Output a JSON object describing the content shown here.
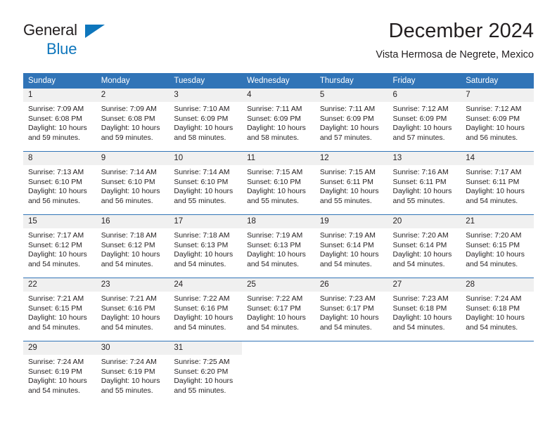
{
  "brand": {
    "word1": "General",
    "word2": "Blue",
    "triangle_color": "#0e76bc",
    "word1_color": "#231f20"
  },
  "header": {
    "title": "December 2024",
    "subtitle": "Vista Hermosa de Negrete, Mexico"
  },
  "theme": {
    "header_bg": "#3174b7",
    "header_text": "#ffffff",
    "daynum_bg": "#f0f0f0",
    "body_text": "#231f20",
    "row_divider": "#3174b7"
  },
  "calendar": {
    "weekday_headers": [
      "Sunday",
      "Monday",
      "Tuesday",
      "Wednesday",
      "Thursday",
      "Friday",
      "Saturday"
    ],
    "weeks": [
      [
        {
          "day": "1",
          "sunrise": "Sunrise: 7:09 AM",
          "sunset": "Sunset: 6:08 PM",
          "daylight1": "Daylight: 10 hours",
          "daylight2": "and 59 minutes."
        },
        {
          "day": "2",
          "sunrise": "Sunrise: 7:09 AM",
          "sunset": "Sunset: 6:08 PM",
          "daylight1": "Daylight: 10 hours",
          "daylight2": "and 59 minutes."
        },
        {
          "day": "3",
          "sunrise": "Sunrise: 7:10 AM",
          "sunset": "Sunset: 6:09 PM",
          "daylight1": "Daylight: 10 hours",
          "daylight2": "and 58 minutes."
        },
        {
          "day": "4",
          "sunrise": "Sunrise: 7:11 AM",
          "sunset": "Sunset: 6:09 PM",
          "daylight1": "Daylight: 10 hours",
          "daylight2": "and 58 minutes."
        },
        {
          "day": "5",
          "sunrise": "Sunrise: 7:11 AM",
          "sunset": "Sunset: 6:09 PM",
          "daylight1": "Daylight: 10 hours",
          "daylight2": "and 57 minutes."
        },
        {
          "day": "6",
          "sunrise": "Sunrise: 7:12 AM",
          "sunset": "Sunset: 6:09 PM",
          "daylight1": "Daylight: 10 hours",
          "daylight2": "and 57 minutes."
        },
        {
          "day": "7",
          "sunrise": "Sunrise: 7:12 AM",
          "sunset": "Sunset: 6:09 PM",
          "daylight1": "Daylight: 10 hours",
          "daylight2": "and 56 minutes."
        }
      ],
      [
        {
          "day": "8",
          "sunrise": "Sunrise: 7:13 AM",
          "sunset": "Sunset: 6:10 PM",
          "daylight1": "Daylight: 10 hours",
          "daylight2": "and 56 minutes."
        },
        {
          "day": "9",
          "sunrise": "Sunrise: 7:14 AM",
          "sunset": "Sunset: 6:10 PM",
          "daylight1": "Daylight: 10 hours",
          "daylight2": "and 56 minutes."
        },
        {
          "day": "10",
          "sunrise": "Sunrise: 7:14 AM",
          "sunset": "Sunset: 6:10 PM",
          "daylight1": "Daylight: 10 hours",
          "daylight2": "and 55 minutes."
        },
        {
          "day": "11",
          "sunrise": "Sunrise: 7:15 AM",
          "sunset": "Sunset: 6:10 PM",
          "daylight1": "Daylight: 10 hours",
          "daylight2": "and 55 minutes."
        },
        {
          "day": "12",
          "sunrise": "Sunrise: 7:15 AM",
          "sunset": "Sunset: 6:11 PM",
          "daylight1": "Daylight: 10 hours",
          "daylight2": "and 55 minutes."
        },
        {
          "day": "13",
          "sunrise": "Sunrise: 7:16 AM",
          "sunset": "Sunset: 6:11 PM",
          "daylight1": "Daylight: 10 hours",
          "daylight2": "and 55 minutes."
        },
        {
          "day": "14",
          "sunrise": "Sunrise: 7:17 AM",
          "sunset": "Sunset: 6:11 PM",
          "daylight1": "Daylight: 10 hours",
          "daylight2": "and 54 minutes."
        }
      ],
      [
        {
          "day": "15",
          "sunrise": "Sunrise: 7:17 AM",
          "sunset": "Sunset: 6:12 PM",
          "daylight1": "Daylight: 10 hours",
          "daylight2": "and 54 minutes."
        },
        {
          "day": "16",
          "sunrise": "Sunrise: 7:18 AM",
          "sunset": "Sunset: 6:12 PM",
          "daylight1": "Daylight: 10 hours",
          "daylight2": "and 54 minutes."
        },
        {
          "day": "17",
          "sunrise": "Sunrise: 7:18 AM",
          "sunset": "Sunset: 6:13 PM",
          "daylight1": "Daylight: 10 hours",
          "daylight2": "and 54 minutes."
        },
        {
          "day": "18",
          "sunrise": "Sunrise: 7:19 AM",
          "sunset": "Sunset: 6:13 PM",
          "daylight1": "Daylight: 10 hours",
          "daylight2": "and 54 minutes."
        },
        {
          "day": "19",
          "sunrise": "Sunrise: 7:19 AM",
          "sunset": "Sunset: 6:14 PM",
          "daylight1": "Daylight: 10 hours",
          "daylight2": "and 54 minutes."
        },
        {
          "day": "20",
          "sunrise": "Sunrise: 7:20 AM",
          "sunset": "Sunset: 6:14 PM",
          "daylight1": "Daylight: 10 hours",
          "daylight2": "and 54 minutes."
        },
        {
          "day": "21",
          "sunrise": "Sunrise: 7:20 AM",
          "sunset": "Sunset: 6:15 PM",
          "daylight1": "Daylight: 10 hours",
          "daylight2": "and 54 minutes."
        }
      ],
      [
        {
          "day": "22",
          "sunrise": "Sunrise: 7:21 AM",
          "sunset": "Sunset: 6:15 PM",
          "daylight1": "Daylight: 10 hours",
          "daylight2": "and 54 minutes."
        },
        {
          "day": "23",
          "sunrise": "Sunrise: 7:21 AM",
          "sunset": "Sunset: 6:16 PM",
          "daylight1": "Daylight: 10 hours",
          "daylight2": "and 54 minutes."
        },
        {
          "day": "24",
          "sunrise": "Sunrise: 7:22 AM",
          "sunset": "Sunset: 6:16 PM",
          "daylight1": "Daylight: 10 hours",
          "daylight2": "and 54 minutes."
        },
        {
          "day": "25",
          "sunrise": "Sunrise: 7:22 AM",
          "sunset": "Sunset: 6:17 PM",
          "daylight1": "Daylight: 10 hours",
          "daylight2": "and 54 minutes."
        },
        {
          "day": "26",
          "sunrise": "Sunrise: 7:23 AM",
          "sunset": "Sunset: 6:17 PM",
          "daylight1": "Daylight: 10 hours",
          "daylight2": "and 54 minutes."
        },
        {
          "day": "27",
          "sunrise": "Sunrise: 7:23 AM",
          "sunset": "Sunset: 6:18 PM",
          "daylight1": "Daylight: 10 hours",
          "daylight2": "and 54 minutes."
        },
        {
          "day": "28",
          "sunrise": "Sunrise: 7:24 AM",
          "sunset": "Sunset: 6:18 PM",
          "daylight1": "Daylight: 10 hours",
          "daylight2": "and 54 minutes."
        }
      ],
      [
        {
          "day": "29",
          "sunrise": "Sunrise: 7:24 AM",
          "sunset": "Sunset: 6:19 PM",
          "daylight1": "Daylight: 10 hours",
          "daylight2": "and 54 minutes."
        },
        {
          "day": "30",
          "sunrise": "Sunrise: 7:24 AM",
          "sunset": "Sunset: 6:19 PM",
          "daylight1": "Daylight: 10 hours",
          "daylight2": "and 55 minutes."
        },
        {
          "day": "31",
          "sunrise": "Sunrise: 7:25 AM",
          "sunset": "Sunset: 6:20 PM",
          "daylight1": "Daylight: 10 hours",
          "daylight2": "and 55 minutes."
        },
        {
          "day": "",
          "sunrise": "",
          "sunset": "",
          "daylight1": "",
          "daylight2": ""
        },
        {
          "day": "",
          "sunrise": "",
          "sunset": "",
          "daylight1": "",
          "daylight2": ""
        },
        {
          "day": "",
          "sunrise": "",
          "sunset": "",
          "daylight1": "",
          "daylight2": ""
        },
        {
          "day": "",
          "sunrise": "",
          "sunset": "",
          "daylight1": "",
          "daylight2": ""
        }
      ]
    ]
  }
}
